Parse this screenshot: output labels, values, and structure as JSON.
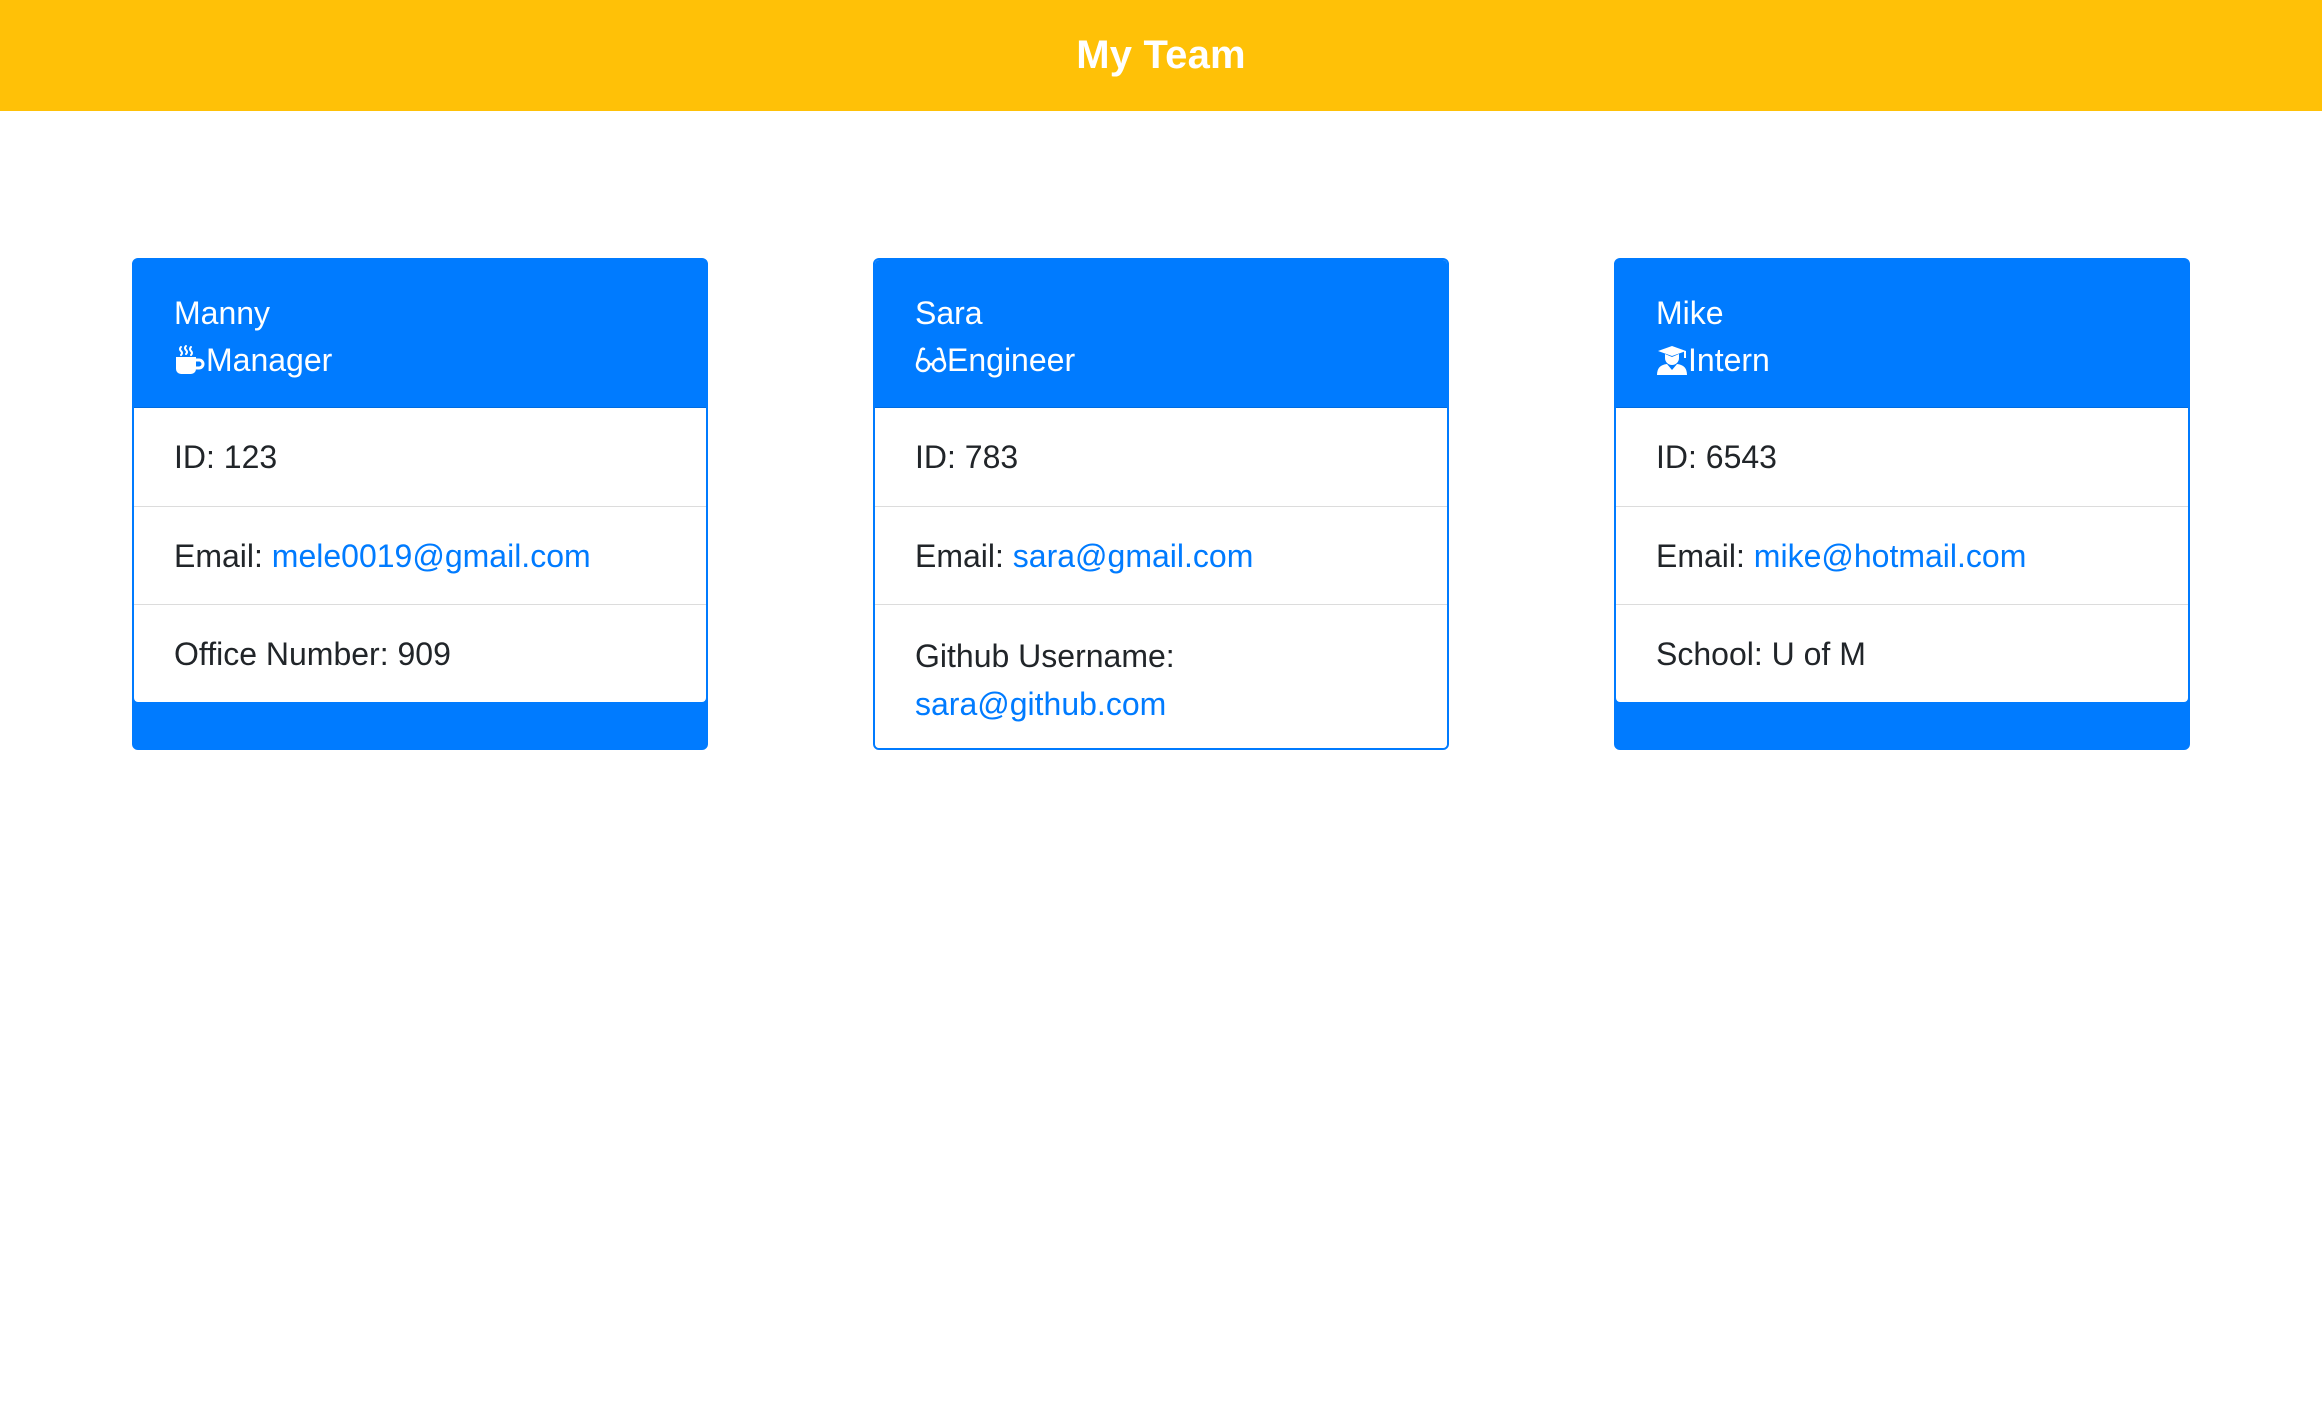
{
  "header": {
    "title": "My Team"
  },
  "team": [
    {
      "name": "Manny",
      "role": "Manager",
      "role_icon": "mug-hot-icon",
      "id_label": "ID:",
      "id": "123",
      "email_label": "Email:",
      "email": "mele0019@gmail.com",
      "extra_label": "Office Number:",
      "extra_value": "909"
    },
    {
      "name": "Sara",
      "role": "Engineer",
      "role_icon": "glasses-icon",
      "id_label": "ID:",
      "id": "783",
      "email_label": "Email:",
      "email": "sara@gmail.com",
      "extra_label": "Github Username:",
      "extra_value": "sara@github.com"
    },
    {
      "name": "Mike",
      "role": "Intern",
      "role_icon": "user-graduate-icon",
      "id_label": "ID:",
      "id": "6543",
      "email_label": "Email:",
      "email": "mike@hotmail.com",
      "extra_label": "School:",
      "extra_value": "U of M"
    }
  ],
  "colors": {
    "header_bg": "#ffc107",
    "card_primary": "#007bff",
    "link": "#007bff",
    "text": "#212529"
  }
}
